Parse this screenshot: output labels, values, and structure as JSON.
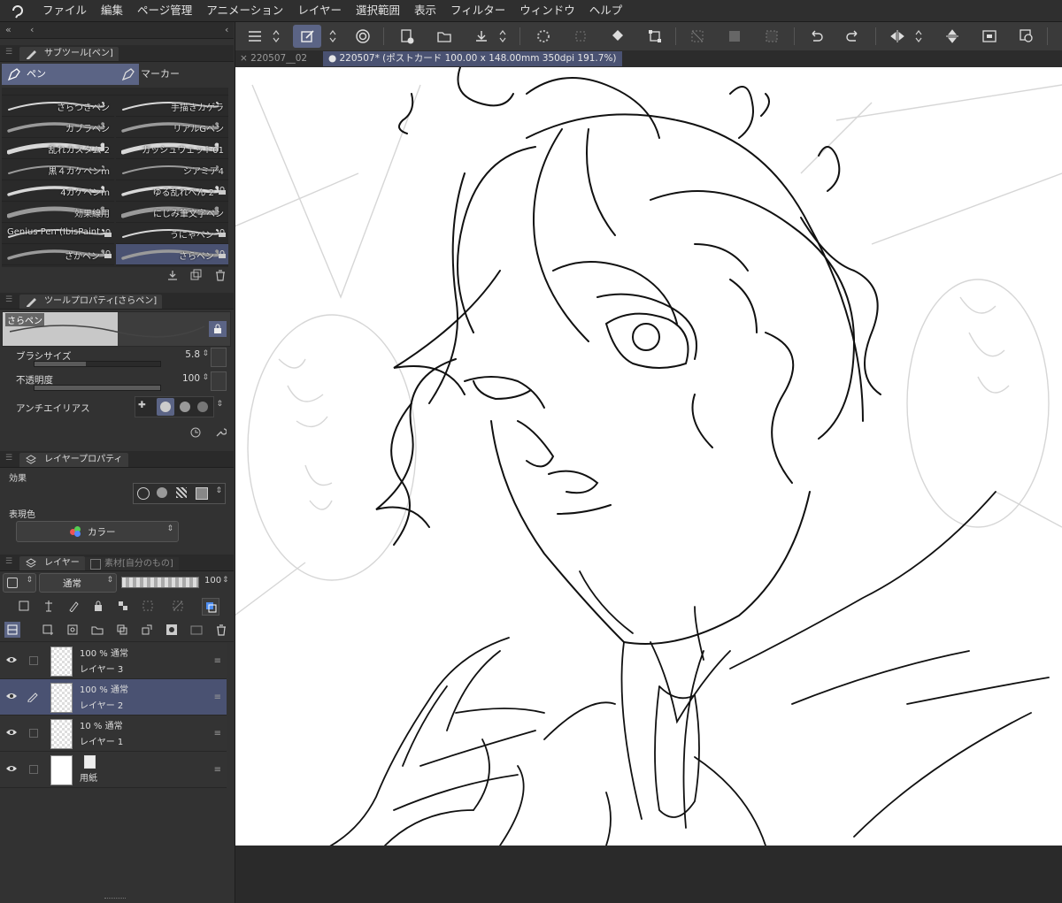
{
  "menu": [
    "ファイル",
    "編集",
    "ページ管理",
    "アニメーション",
    "レイヤー",
    "選択範囲",
    "表示",
    "フィルター",
    "ウィンドウ",
    "ヘルプ"
  ],
  "tabs": [
    {
      "label": "220507__02",
      "active": false
    },
    {
      "label": "220507* (ポストカード 100.00 x 148.00mm 350dpi 191.7%)",
      "active": true
    }
  ],
  "subtool": {
    "panel_title": "サブツール[ペン]",
    "tabs": [
      {
        "label": "ペン",
        "active": true
      },
      {
        "label": "マーカー",
        "active": false
      }
    ],
    "brushes_left": [
      "さらつきペン",
      "カブラペン",
      "乱れカスタム 2",
      "黒４カケペンm",
      "4カケペンm",
      "効果線用",
      "Genius Pen (IbisPaint",
      "ざかペン"
    ],
    "brushes_right": [
      "手描きカゲラ",
      "リアルGペン",
      "ガッシュウェット01",
      "シアミア4",
      "ゆる乱れぺん 2",
      "にじみ筆文字ペン",
      "うにゃペン",
      "さらペン"
    ]
  },
  "tool_property": {
    "panel_title": "ツールプロパティ[さらペン]",
    "brush_name": "さらペン",
    "brush_size_label": "ブラシサイズ",
    "brush_size": "5.8",
    "brush_size_fraction": 0.41,
    "opacity_label": "不透明度",
    "opacity": "100",
    "opacity_fraction": 1.0,
    "antialias_label": "アンチエイリアス"
  },
  "layer_property": {
    "panel_title": "レイヤープロパティ",
    "effect_label": "効果",
    "expression_label": "表現色",
    "color_mode": "カラー"
  },
  "layers_panel": {
    "tab_label": "レイヤー",
    "tab2_label": "素材[自分のもの]",
    "blend_mode": "通常",
    "opacity": "100",
    "layers": [
      {
        "mode": "100 %  通常",
        "name": "レイヤー 3",
        "selected": false,
        "paper": false
      },
      {
        "mode": "100 %  通常",
        "name": "レイヤー 2",
        "selected": true,
        "paper": false
      },
      {
        "mode": "10 %  通常",
        "name": "レイヤー 1",
        "selected": false,
        "paper": false
      },
      {
        "mode": "",
        "name": "用紙",
        "selected": false,
        "paper": true
      }
    ]
  },
  "colors": {
    "accent": "#5b6485",
    "panel": "#323232",
    "canvas": "#ffffff"
  }
}
